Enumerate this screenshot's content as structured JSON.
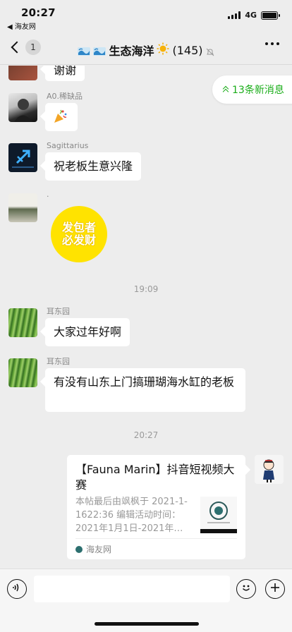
{
  "status_bar": {
    "time": "20:27",
    "back_app": "◀ 海友网",
    "network": "4G"
  },
  "header": {
    "unread_count": "1",
    "title": "生态海洋",
    "member_count": "(145)"
  },
  "new_messages": "13条新消息",
  "messages": [
    {
      "type": "text",
      "text": "谢谢"
    },
    {
      "type": "emoji",
      "sender": "A0.稀缺品"
    },
    {
      "type": "text",
      "sender": "Sagittarius",
      "text": "祝老板生意兴隆"
    },
    {
      "type": "sticker",
      "sender": ".",
      "sticker_text": [
        "发包者",
        "必发财"
      ]
    },
    {
      "type": "time",
      "text": "19:09"
    },
    {
      "type": "text",
      "sender": "耳东园",
      "text": "大家过年好啊"
    },
    {
      "type": "text",
      "sender": "耳东园",
      "text": "有没有山东上门搞珊瑚海水缸的老板"
    },
    {
      "type": "time",
      "text": "20:27"
    },
    {
      "type": "link",
      "title": "【Fauna Marin】抖音短视频大赛",
      "description": "本帖最后由飒枫于 2021-1-1622:36 编辑活动时间：2021年1月1日-2021年…",
      "source": "海友网"
    }
  ],
  "colors": {
    "background": "#ededed",
    "accent_green": "#1aad19",
    "bubble": "#ffffff"
  }
}
